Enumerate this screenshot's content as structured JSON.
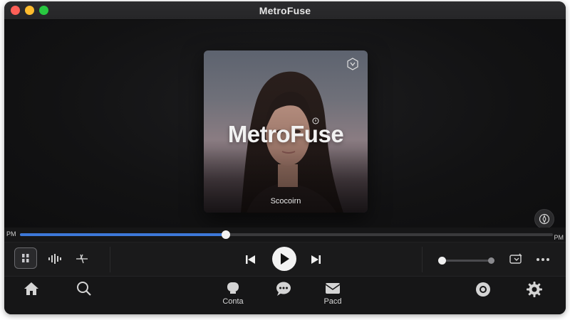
{
  "window": {
    "title": "MetroFuse"
  },
  "cover": {
    "brand": "MetroFuse",
    "subtitle": "Scocoirn"
  },
  "progress": {
    "elapsed": "PM",
    "total": "PM",
    "fraction": 0.387
  },
  "volume": {
    "level": 0.0
  },
  "nav": {
    "items": [
      {
        "label": "",
        "icon": "home-icon"
      },
      {
        "label": "",
        "icon": "search-icon"
      },
      {
        "label": "Conta",
        "icon": "chat-bubble-icon"
      },
      {
        "label": "",
        "icon": "messages-icon"
      },
      {
        "label": "Pacd",
        "icon": "mail-icon"
      },
      {
        "label": "",
        "icon": "record-icon"
      },
      {
        "label": "",
        "icon": "gear-icon"
      }
    ]
  },
  "colors": {
    "accent": "#3d78d8",
    "background": "#141414",
    "titlebar": "#2c2c2e"
  }
}
